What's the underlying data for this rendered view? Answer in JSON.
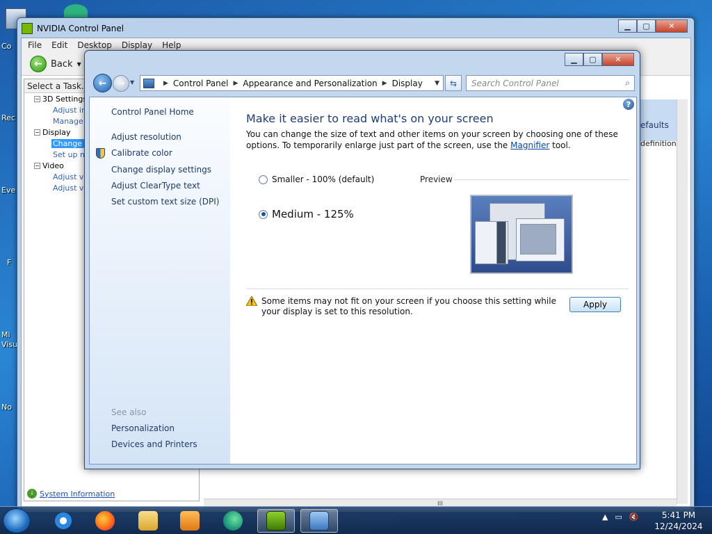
{
  "desktop": {
    "labels": [
      "Co",
      "Rec",
      "Eve",
      "F",
      "Mi\nVisu",
      "No"
    ]
  },
  "nvidia": {
    "title": "NVIDIA Control Panel",
    "menu": [
      "File",
      "Edit",
      "Desktop",
      "Display",
      "Help"
    ],
    "back_label": "Back",
    "task_label": "Select a Task...",
    "tree": {
      "settings3d": "3D Settings",
      "adjust_im": "Adjust im",
      "manage": "Manage",
      "display": "Display",
      "change_r": "Change r",
      "set_up_m": "Set up m",
      "video": "Video",
      "adjust_vi1": "Adjust vi",
      "adjust_vi2": "Adjust vi"
    },
    "right_text1": "efaults",
    "right_text2": "definition (H",
    "system_information": "System Information",
    "scroll_grip": "III"
  },
  "control_panel": {
    "breadcrumb": [
      "Control Panel",
      "Appearance and Personalization",
      "Display"
    ],
    "search_placeholder": "Search Control Panel",
    "sidebar": {
      "home": "Control Panel Home",
      "adjust_resolution": "Adjust resolution",
      "calibrate_color": "Calibrate color",
      "change_display_settings": "Change display settings",
      "adjust_cleartype": "Adjust ClearType text",
      "custom_dpi": "Set custom text size (DPI)",
      "see_also": "See also",
      "personalization": "Personalization",
      "devices_printers": "Devices and Printers"
    },
    "heading": "Make it easier to read what's on your screen",
    "description_1": "You can change the size of text and other items on your screen by choosing one of these options. To temporarily enlarge just part of the screen, use the",
    "magnifier_link": "Magnifier",
    "description_2": "tool.",
    "options": [
      {
        "label": "Smaller - 100% (default)",
        "selected": false
      },
      {
        "label": "Medium - 125%",
        "selected": true
      }
    ],
    "preview_label": "Preview",
    "warning": "Some items may not fit on your screen if you choose this setting while your display is set to this resolution.",
    "apply_label": "Apply",
    "help_glyph": "?"
  },
  "taskbar": {
    "time": "5:41 PM",
    "date": "12/24/2024",
    "apps": [
      "internet-explorer",
      "firefox",
      "file-explorer",
      "media-player",
      "edge",
      "nvidia-control-panel",
      "control-panel"
    ]
  },
  "colors": {
    "accent": "#1e3c78",
    "link": "#1c3a6a",
    "nvidia_green": "#76b900"
  }
}
